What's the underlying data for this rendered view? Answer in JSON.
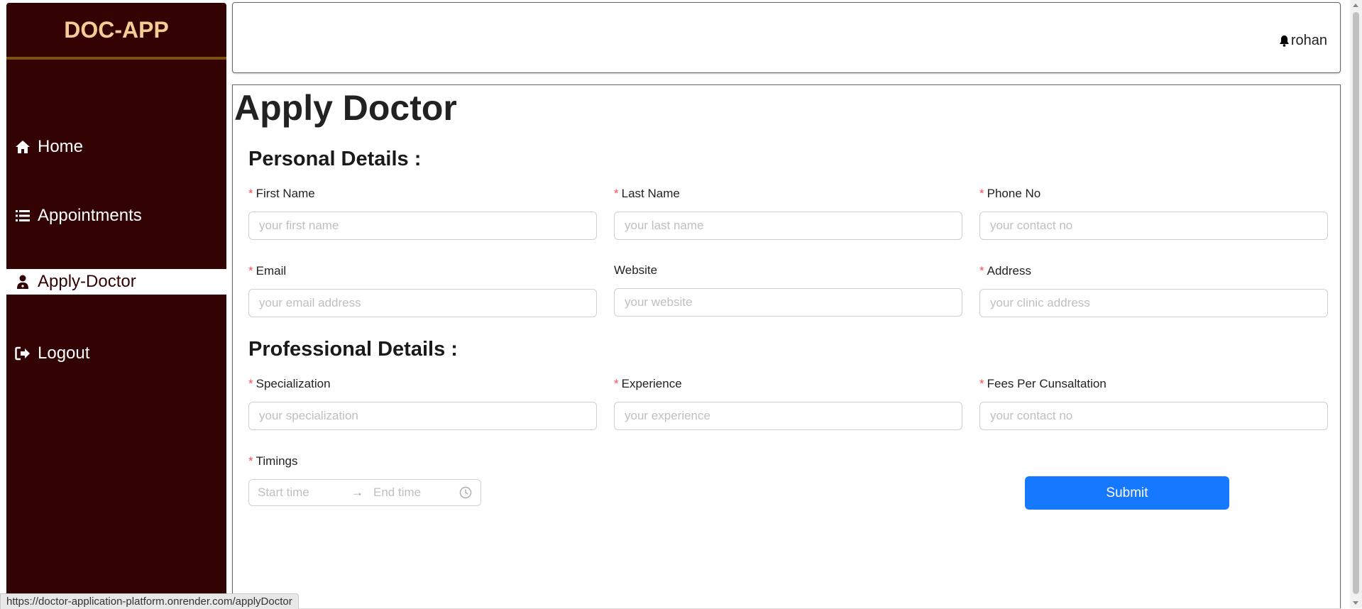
{
  "app": {
    "logo": "DOC-APP"
  },
  "sidebar": {
    "items": [
      {
        "label": "Home",
        "icon": "home-icon",
        "active": false
      },
      {
        "label": "Appointments",
        "icon": "list-icon",
        "active": false
      },
      {
        "label": "Apply-Doctor",
        "icon": "user-doctor-icon",
        "active": true
      },
      {
        "label": "Logout",
        "icon": "logout-icon",
        "active": false
      }
    ]
  },
  "header": {
    "user_name": "rohan",
    "notification_icon": "bell-icon"
  },
  "page": {
    "title": "Apply Doctor",
    "personal_section": "Personal Details :",
    "professional_section": "Professional Details :",
    "submit_label": "Submit"
  },
  "form": {
    "first_name": {
      "label": "First Name",
      "required": true,
      "placeholder": "your first name",
      "value": ""
    },
    "last_name": {
      "label": "Last Name",
      "required": true,
      "placeholder": "your last name",
      "value": ""
    },
    "phone": {
      "label": "Phone No",
      "required": true,
      "placeholder": "your contact no",
      "value": ""
    },
    "email": {
      "label": "Email",
      "required": true,
      "placeholder": "your email address",
      "value": ""
    },
    "website": {
      "label": "Website",
      "required": false,
      "placeholder": "your website",
      "value": ""
    },
    "address": {
      "label": "Address",
      "required": true,
      "placeholder": "your clinic address",
      "value": ""
    },
    "specialization": {
      "label": "Specialization",
      "required": true,
      "placeholder": "your specialization",
      "value": ""
    },
    "experience": {
      "label": "Experience",
      "required": true,
      "placeholder": "your experience",
      "value": ""
    },
    "fees": {
      "label": "Fees Per Cunsaltation",
      "required": true,
      "placeholder": "your contact no",
      "value": ""
    },
    "timings": {
      "label": "Timings",
      "required": true,
      "start_placeholder": "Start time",
      "end_placeholder": "End time"
    }
  },
  "required_marker": "*",
  "arrow_glyph": "→",
  "status_url": "https://doctor-application-platform.onrender.com/applyDoctor",
  "colors": {
    "sidebar_bg": "#330202",
    "logo": "#f5cc96",
    "primary": "#1677ff",
    "required": "#ff4d4f"
  }
}
